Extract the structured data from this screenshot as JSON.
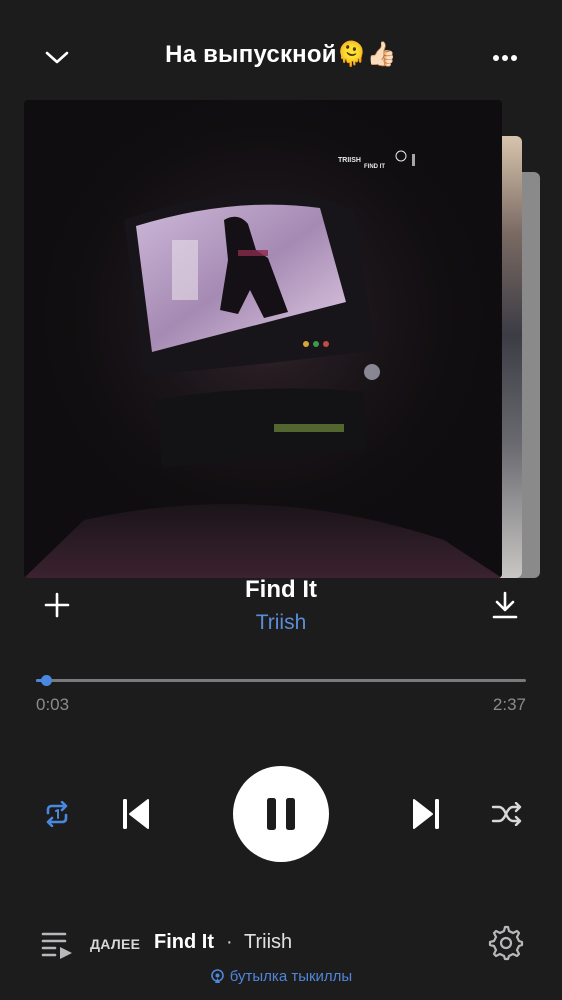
{
  "header": {
    "title": "На выпускной🫠👍🏻",
    "back_icon": "chevron-down-icon",
    "more_icon": "more-horizontal-icon"
  },
  "cover": {
    "artist_text": "TRIISH",
    "title_text": "FIND IT"
  },
  "track": {
    "title": "Find It",
    "artist": "Triish",
    "artist_color": "#5b8dd6"
  },
  "progress": {
    "current": "0:03",
    "total": "2:37",
    "fraction": 0.02,
    "accent": "#4a88e0"
  },
  "controls": {
    "repeat_icon": "repeat-icon",
    "prev_icon": "skip-previous-icon",
    "play_state_icon": "pause-icon",
    "next_icon": "skip-next-icon",
    "shuffle_icon": "shuffle-icon",
    "repeat_active": true
  },
  "up_next": {
    "label": "ДАЛЕЕ",
    "title": "Find It",
    "separator": "·",
    "artist": "Triish"
  },
  "broadcast": {
    "text": "бутылка тыкиллы"
  }
}
